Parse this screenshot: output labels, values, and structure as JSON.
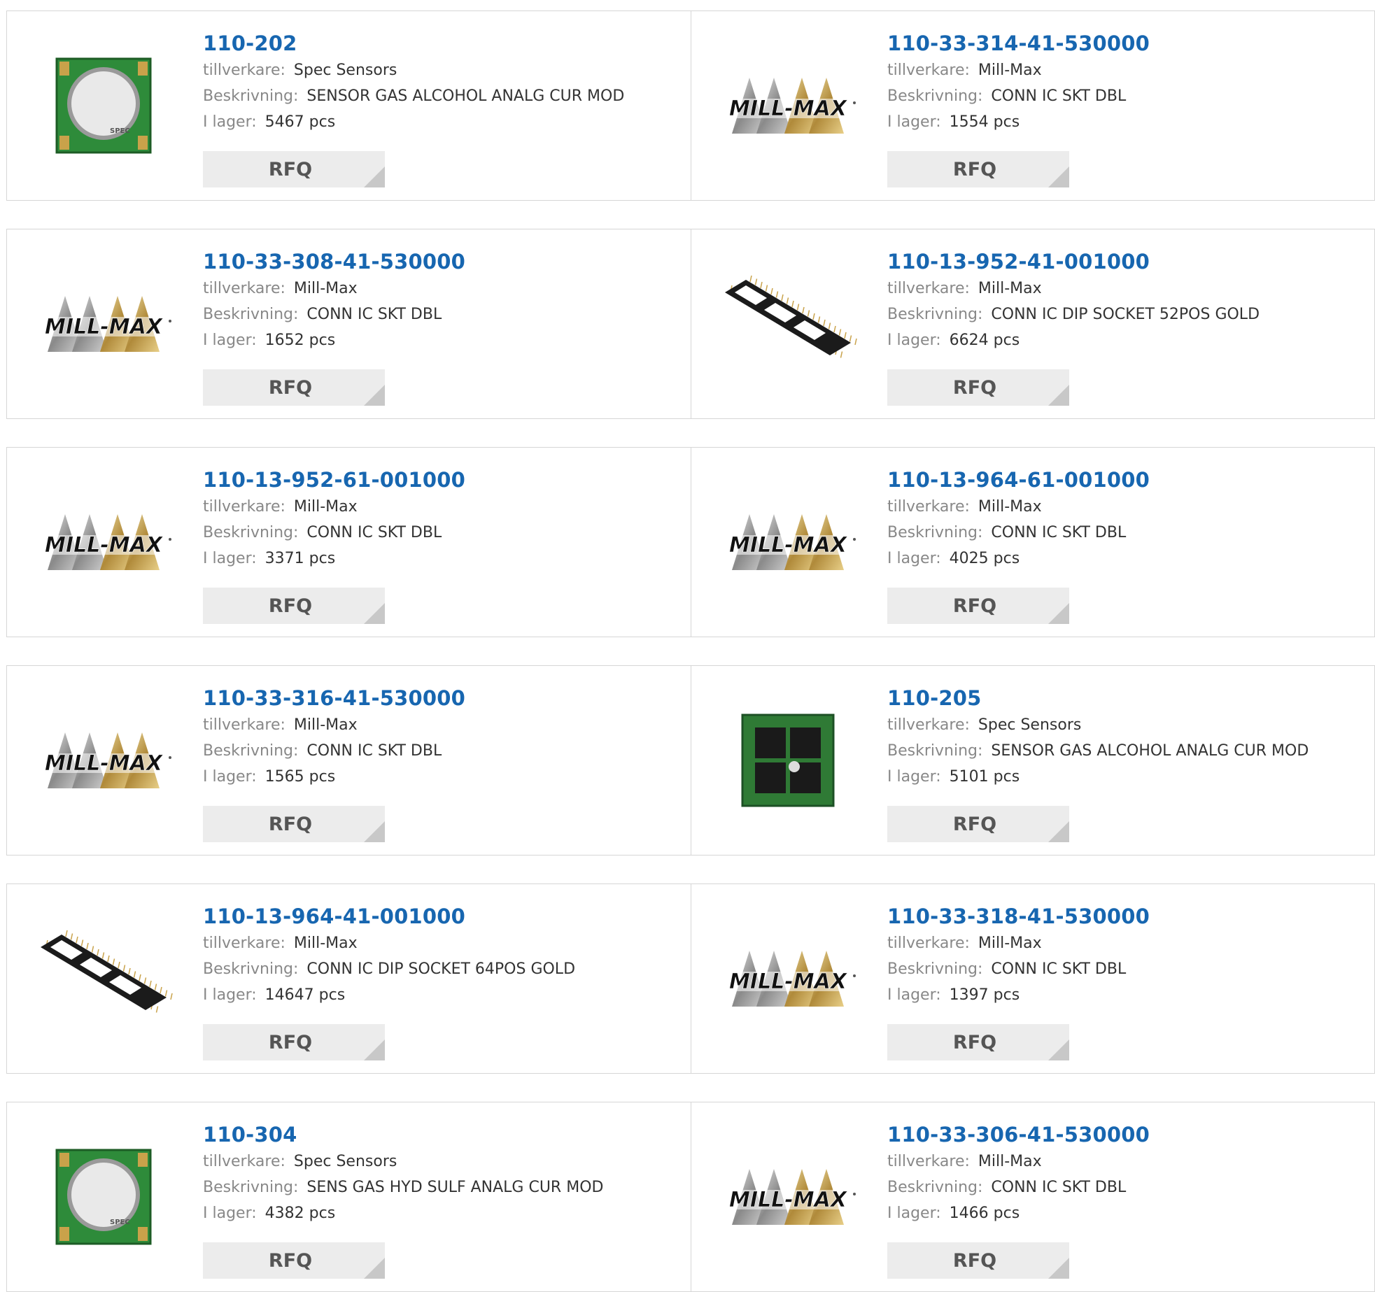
{
  "labels": {
    "manufacturer": "tillverkare:",
    "description": "Beskrivning:",
    "stock": "I lager:",
    "rfq": "RFQ"
  },
  "products": [
    {
      "part": "110-202",
      "manufacturer": "Spec Sensors",
      "description": "SENSOR GAS ALCOHOL ANALG CUR MOD",
      "stock": "5467 pcs",
      "image": "sensor-module-round-icon"
    },
    {
      "part": "110-33-314-41-530000",
      "manufacturer": "Mill-Max",
      "description": "CONN IC SKT DBL",
      "stock": "1554 pcs",
      "image": "mill-max-logo"
    },
    {
      "part": "110-33-308-41-530000",
      "manufacturer": "Mill-Max",
      "description": "CONN IC SKT DBL",
      "stock": "1652 pcs",
      "image": "mill-max-logo"
    },
    {
      "part": "110-13-952-41-001000",
      "manufacturer": "Mill-Max",
      "description": "CONN IC DIP SOCKET 52POS GOLD",
      "stock": "6624 pcs",
      "image": "dip-socket-icon"
    },
    {
      "part": "110-13-952-61-001000",
      "manufacturer": "Mill-Max",
      "description": "CONN IC SKT DBL",
      "stock": "3371 pcs",
      "image": "mill-max-logo"
    },
    {
      "part": "110-13-964-61-001000",
      "manufacturer": "Mill-Max",
      "description": "CONN IC SKT DBL",
      "stock": "4025 pcs",
      "image": "mill-max-logo"
    },
    {
      "part": "110-33-316-41-530000",
      "manufacturer": "Mill-Max",
      "description": "CONN IC SKT DBL",
      "stock": "1565 pcs",
      "image": "mill-max-logo"
    },
    {
      "part": "110-205",
      "manufacturer": "Spec Sensors",
      "description": "SENSOR GAS ALCOHOL ANALG CUR MOD",
      "stock": "5101 pcs",
      "image": "sensor-module-square-icon"
    },
    {
      "part": "110-13-964-41-001000",
      "manufacturer": "Mill-Max",
      "description": "CONN IC DIP SOCKET 64POS GOLD",
      "stock": "14647 pcs",
      "image": "dip-socket-icon"
    },
    {
      "part": "110-33-318-41-530000",
      "manufacturer": "Mill-Max",
      "description": "CONN IC SKT DBL",
      "stock": "1397 pcs",
      "image": "mill-max-logo"
    },
    {
      "part": "110-304",
      "manufacturer": "Spec Sensors",
      "description": "SENS GAS HYD SULF ANALG CUR MOD",
      "stock": "4382 pcs",
      "image": "sensor-module-round-icon"
    },
    {
      "part": "110-33-306-41-530000",
      "manufacturer": "Mill-Max",
      "description": "CONN IC SKT DBL",
      "stock": "1466 pcs",
      "image": "mill-max-logo"
    }
  ],
  "logo_text": "MILL-MAX",
  "sensor_brand": "SPEC",
  "colors": {
    "part_link": "#1766b0",
    "label": "#888888",
    "value": "#333333",
    "rfq_bg": "#ececec",
    "border": "#d6d6d6"
  }
}
